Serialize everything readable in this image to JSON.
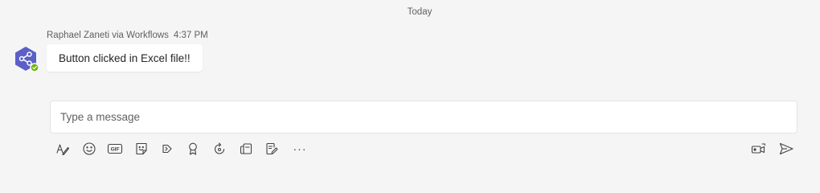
{
  "conversation": {
    "date_divider": "Today"
  },
  "message": {
    "sender": "Raphael Zaneti via Workflows",
    "time": "4:37 PM",
    "text": "Button clicked in Excel file!!",
    "avatar_icon": "workflows-share-icon",
    "avatar_color": "#5b5fc7",
    "status_color": "#6bb700"
  },
  "composer": {
    "placeholder": "Type a message"
  },
  "toolbar": {
    "icons": [
      "format-icon",
      "emoji-icon",
      "gif-icon",
      "sticker-icon",
      "meet-now-icon",
      "praise-icon",
      "loop-icon",
      "schedule-icon",
      "approvals-icon",
      "more-options-icon"
    ],
    "gif_label": "GIF",
    "more_label": "···",
    "right_icons": [
      "video-clip-icon",
      "send-icon"
    ]
  }
}
